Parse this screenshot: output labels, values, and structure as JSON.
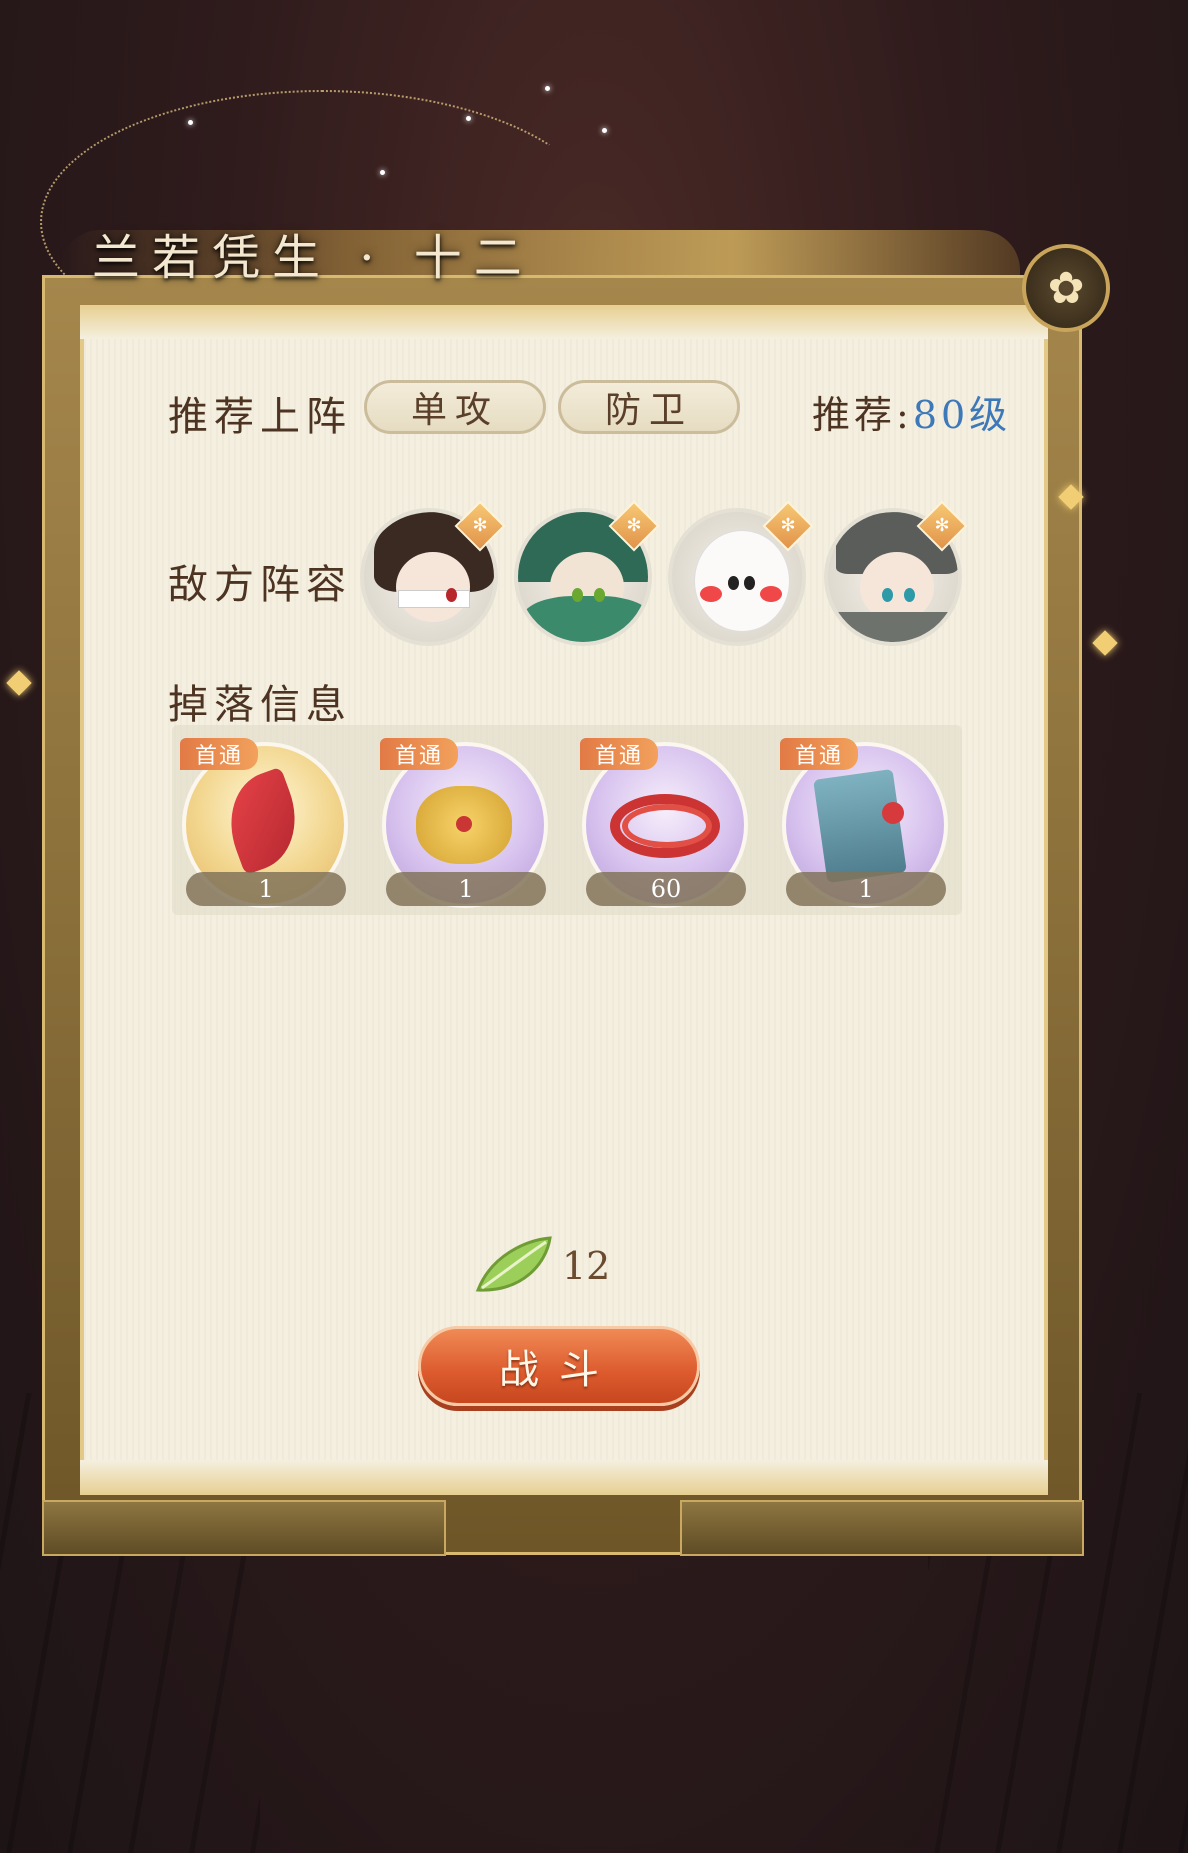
{
  "stage": {
    "title": "兰若凭生 · 十二"
  },
  "recommend": {
    "label": "推荐上阵",
    "roles": [
      "单攻",
      "防卫"
    ],
    "level_label": "推荐:",
    "level_value": "80级"
  },
  "enemies": {
    "label": "敌方阵容",
    "items": [
      {
        "name": "enemy-1"
      },
      {
        "name": "enemy-2"
      },
      {
        "name": "enemy-3"
      },
      {
        "name": "enemy-4"
      }
    ]
  },
  "drops": {
    "label": "掉落信息",
    "items": [
      {
        "tag": "首通",
        "count": "1",
        "style": "gold"
      },
      {
        "tag": "首通",
        "count": "1",
        "style": "purple"
      },
      {
        "tag": "首通",
        "count": "60",
        "style": "purple"
      },
      {
        "tag": "首通",
        "count": "1",
        "style": "purple"
      }
    ]
  },
  "cost": {
    "amount": "12",
    "icon": "leaf-icon"
  },
  "battle_button": {
    "label": "战斗"
  },
  "colors": {
    "accent": "#dc5a2d",
    "level": "#3d78b8",
    "frame": "#d8b970"
  }
}
